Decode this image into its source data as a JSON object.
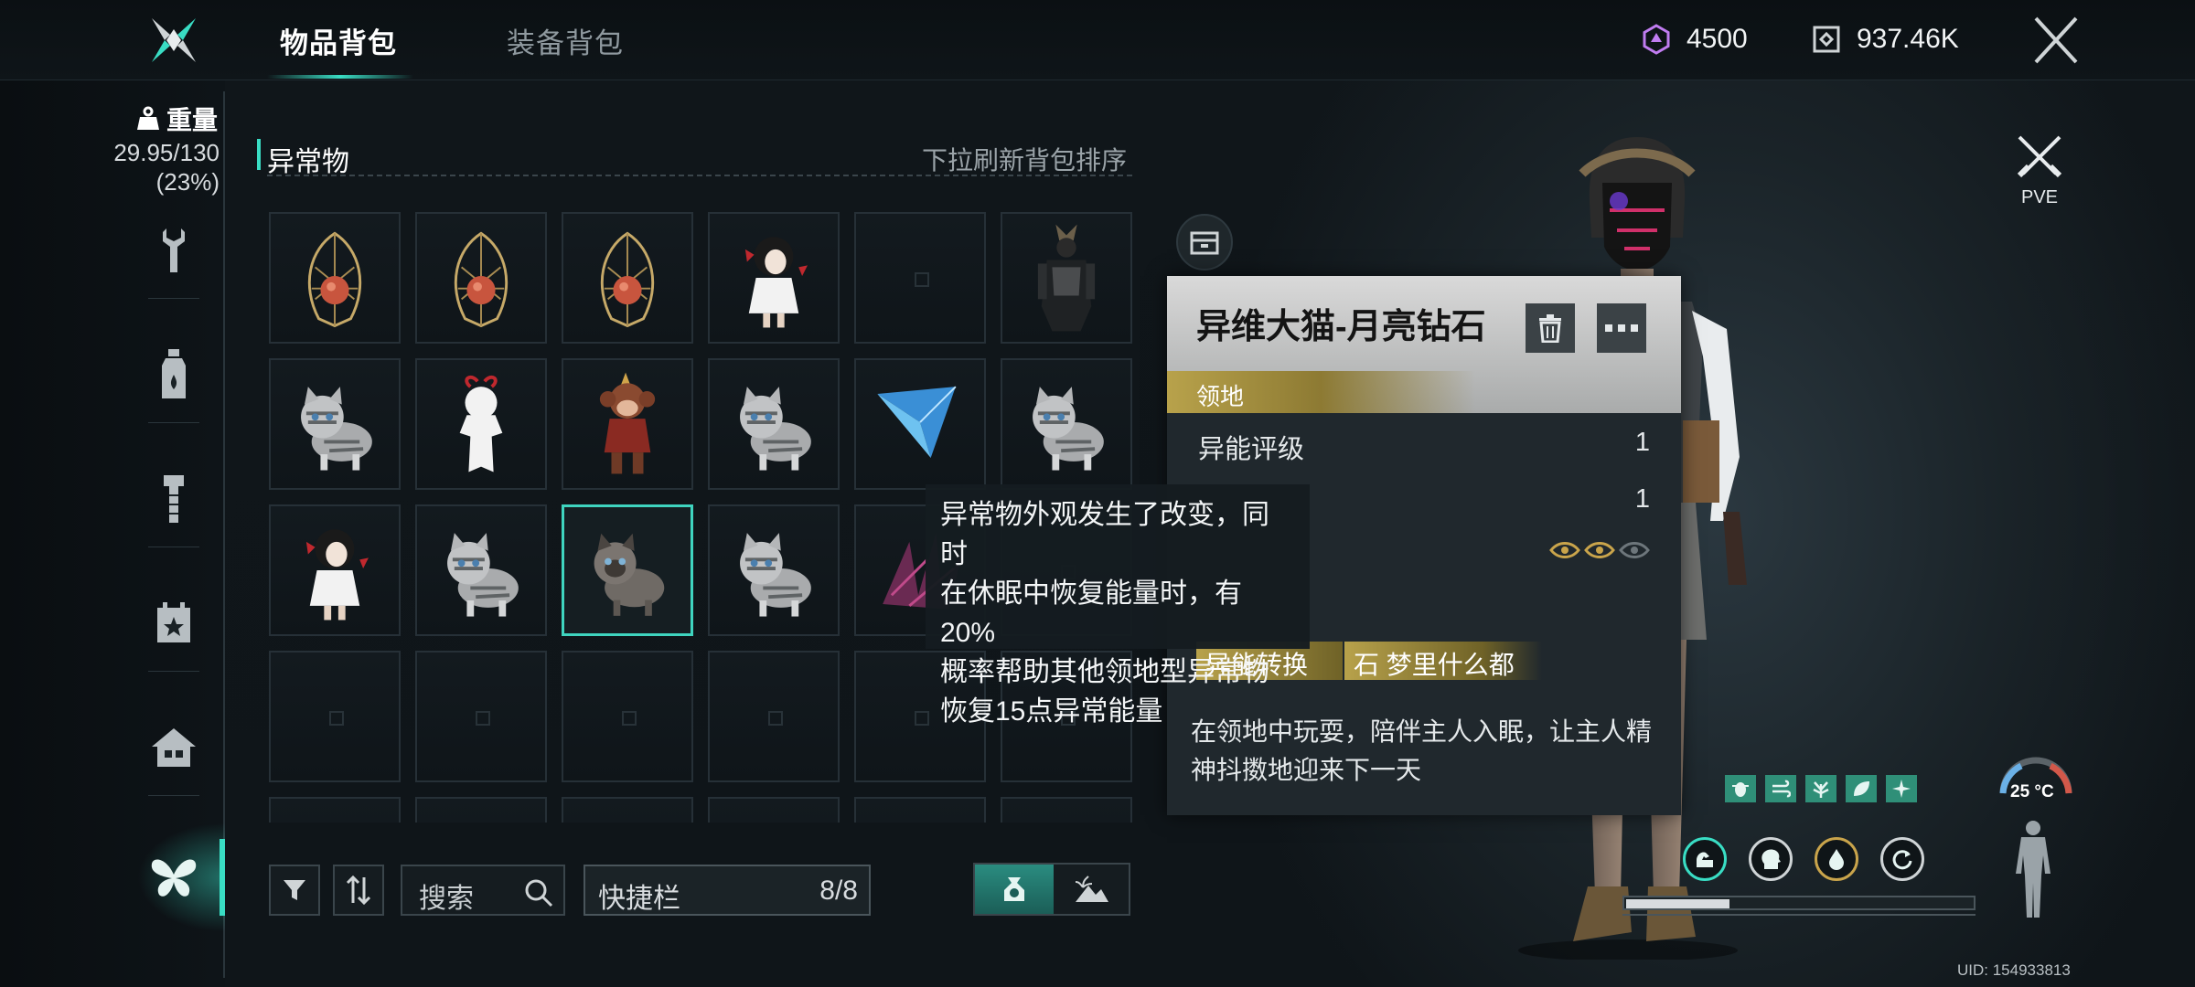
{
  "tabs": [
    {
      "label": "物品背包"
    },
    {
      "label": "装备背包"
    }
  ],
  "currencies": [
    {
      "icon": "energy-crystal-icon",
      "value": "4500"
    },
    {
      "icon": "coin-icon",
      "value": "937.46K"
    }
  ],
  "weight": {
    "label": "重量",
    "value": "29.95/130",
    "percent": "(23%)"
  },
  "sidebar": {
    "items": [
      {
        "icon": "wrench-icon"
      },
      {
        "icon": "bottle-icon"
      },
      {
        "icon": "bolt-icon"
      },
      {
        "icon": "calendar-star-icon"
      },
      {
        "icon": "house-icon"
      },
      {
        "icon": "butterfly-icon",
        "active": true
      }
    ]
  },
  "section": {
    "title": "异常物",
    "hint": "下拉刷新背包排序"
  },
  "grid": {
    "rows": [
      [
        "lantern",
        "lantern",
        "lantern",
        "doll",
        "empty",
        "samurai"
      ],
      [
        "cat",
        "paper-doll",
        "monkey",
        "cat",
        "crystal-wing",
        "cat"
      ],
      [
        "doll",
        "cat",
        "cat-dark",
        "cat",
        "thorn",
        "empty"
      ],
      [
        "empty",
        "empty",
        "empty",
        "empty",
        "empty",
        "empty"
      ]
    ],
    "selected": {
      "row": 2,
      "col": 2
    }
  },
  "controls": {
    "search_label": "搜索",
    "quickbar_label": "快捷栏",
    "quickbar_count": "8/8"
  },
  "detail": {
    "name": "异维大猫-月亮钻石",
    "type": "领地",
    "stats": [
      {
        "label": "异能评级",
        "value": "1"
      },
      {
        "label": "",
        "value": "1"
      }
    ],
    "tags": [
      "异能转换",
      "石  梦里什么都"
    ],
    "description": "在领地中玩耍，陪伴主人入眠，让主人精神抖擞地迎来下一天"
  },
  "tooltip": {
    "lines": [
      "异常物外观发生了改变，同时",
      "在休眠中恢复能量时，有20%",
      "概率帮助其他领地型异常物",
      "恢复15点异常能量"
    ]
  },
  "right_panel": {
    "mode_label": "PVE",
    "temperature": "25 °C",
    "progress": 0.3
  },
  "uid": "UID: 154933813",
  "colors": {
    "accent": "#39ddc4",
    "gold": "#b8a24b"
  }
}
